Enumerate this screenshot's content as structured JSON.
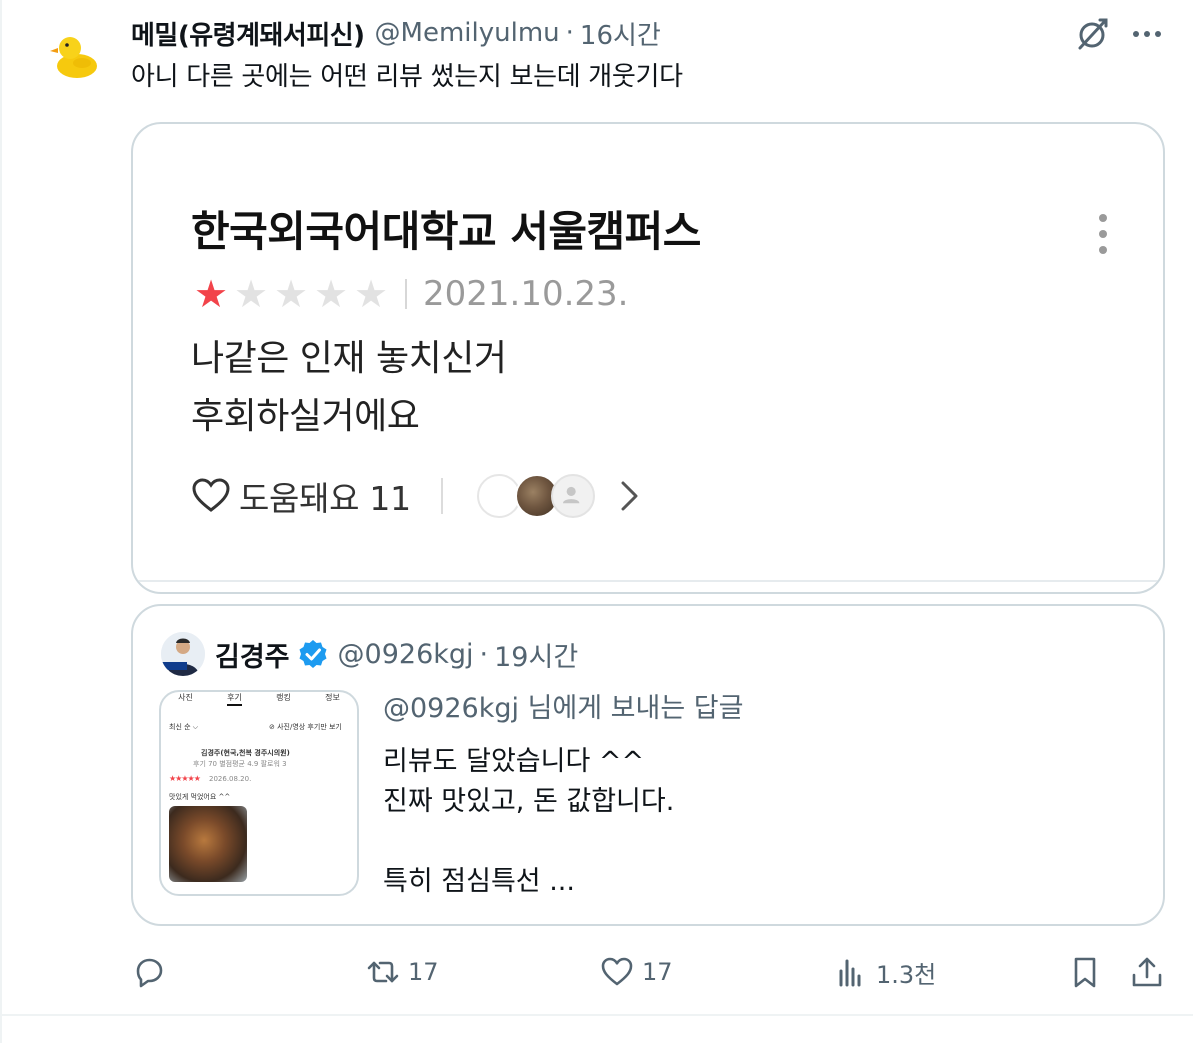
{
  "tweet": {
    "display_name": "메밀(유령계돼서피신)",
    "handle": "@Memilyulmu",
    "separator": "·",
    "time": "16시간",
    "text": "아니 다른 곳에는 어떤 리뷰 썼는지 보는데 개웃기다"
  },
  "review_card": {
    "place_title": "한국외국어대학교 서울캠퍼스",
    "rating": 1,
    "max_rating": 5,
    "date": "2021.10.23.",
    "body_line1": "나같은 인재 놓치신거",
    "body_line2": "후회하실거에요",
    "helpful_label": "도움돼요 11"
  },
  "quoted_tweet": {
    "display_name": "김경주",
    "handle": "@0926kgj",
    "separator": "·",
    "time": "19시간",
    "reply_to": "@0926kgj 님에게 보내는 답글",
    "text": "리뷰도 달았습니다 ^^\n진짜 맛있고, 돈 값합니다.\n\n특히 점심특선 ...",
    "thumbnail": {
      "tabs": [
        "사진",
        "후기",
        "랭킹",
        "정보"
      ],
      "sort_label": "최신 순 ⌵",
      "filter_label": "⊘ 사진/영상 후기만 보기",
      "reviewer": "김경주(현국,천복 경주시의원)",
      "reviewer_meta": "후기 70  별점평균 4.9  팔로워 3",
      "review_date": "2026.08.20.",
      "review_text": "맛있게 먹었어요 ^^"
    }
  },
  "actions": {
    "reply_count": "",
    "retweet_count": "17",
    "like_count": "17",
    "views_count": "1.3천"
  },
  "colors": {
    "accent_star": "#f2434a",
    "muted_text": "#536471",
    "border": "#cfd9de",
    "verified_blue": "#1d9bf0"
  },
  "icons": [
    "grok-icon",
    "more-icon",
    "kebab-icon",
    "heart-icon",
    "chevron-right-icon",
    "verified-badge-icon",
    "reply-icon",
    "retweet-icon",
    "like-icon",
    "views-icon",
    "bookmark-icon",
    "share-icon"
  ]
}
